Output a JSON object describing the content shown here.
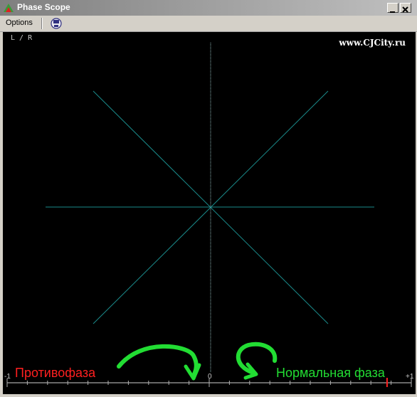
{
  "window": {
    "title": "Phase Scope"
  },
  "menu": {
    "options_label": "Options"
  },
  "scope": {
    "channel_label": "L / R",
    "website": "www.CJCity.ru",
    "scale": {
      "min_label": "-1",
      "zero_label": "0",
      "max_label": "+1"
    },
    "annotations": {
      "antiphase": "Противофаза",
      "normal_phase": "Нормальная фаза"
    },
    "correlation_value": 0.88
  },
  "colors": {
    "trace": "#1a8a8a",
    "background": "#000000",
    "antiphase_text": "#ff2020",
    "normal_phase_text": "#22dd33",
    "indicator": "#ff2020"
  }
}
